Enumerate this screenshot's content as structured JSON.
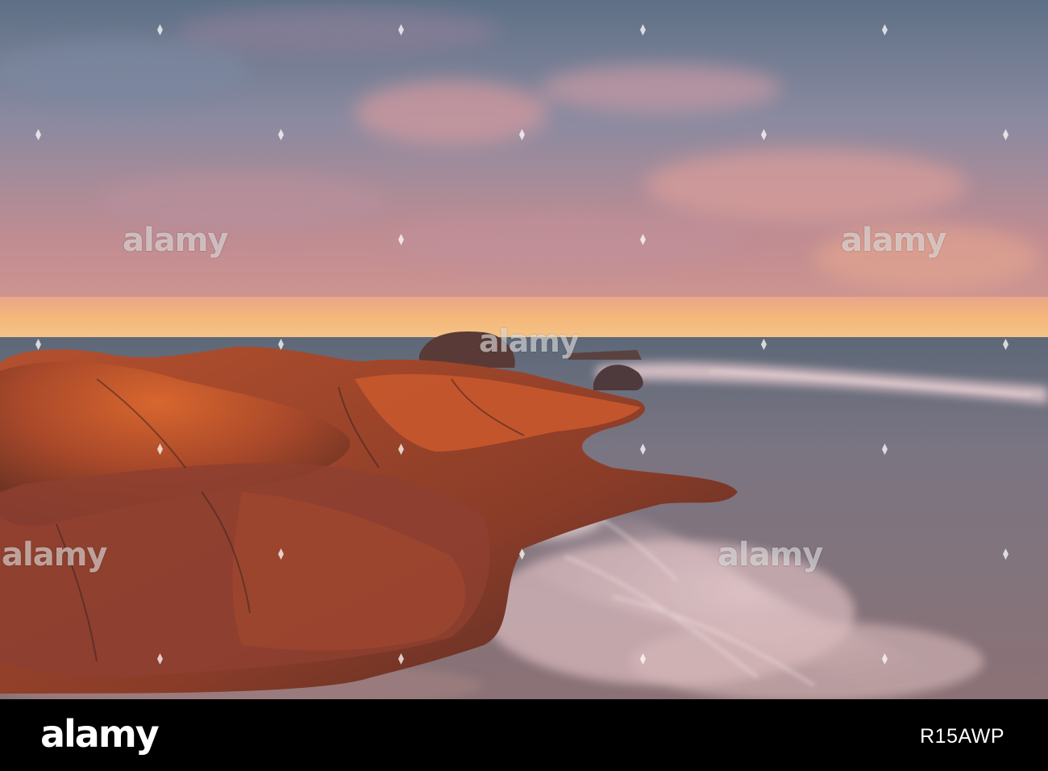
{
  "photo": {
    "subject": "sunset-rocky-shore",
    "palette": {
      "sky_top": "#6a7c92",
      "sky_pink": "#c98c8c",
      "horizon_glow": "#f2b070",
      "sea": "#6f7886",
      "rock_lit": "#c8582c",
      "rock_shadow": "#4a2a24",
      "foam": "#f3d9dc"
    }
  },
  "watermark": {
    "text": "alamy"
  },
  "footer": {
    "logo": "alamy",
    "image_id": "R15AWP"
  }
}
